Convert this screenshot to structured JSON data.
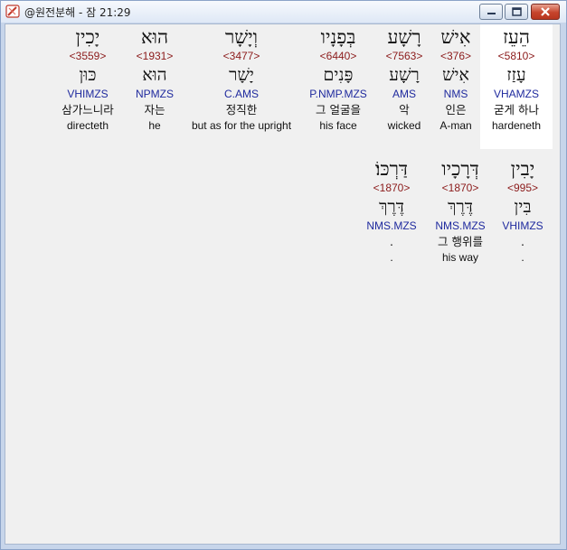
{
  "window": {
    "title": "@원전분해 - 잠 21:29"
  },
  "rows": [
    {
      "words": [
        {
          "hebrew": "הֵעֵז",
          "strongs": "<5810>",
          "lexeme": "עָזַז",
          "parsing": "VHAMZS",
          "korean": "굳게 하나",
          "english": "hardeneth",
          "highlighted": true
        },
        {
          "hebrew": "אִישׁ",
          "strongs": "<376>",
          "lexeme": "אִישׁ",
          "parsing": "NMS",
          "korean": "인은",
          "english": "A-man"
        },
        {
          "hebrew": "רָשָׁע",
          "strongs": "<7563>",
          "lexeme": "רָשָׁע",
          "parsing": "AMS",
          "korean": "악",
          "english": "wicked"
        },
        {
          "hebrew": "בְּפָנָיו",
          "strongs": "<6440>",
          "lexeme": "פָּנִים",
          "parsing": "P.NMP.MZS",
          "korean": "그 얼굴을",
          "english": "his face"
        },
        {
          "hebrew": "וְיָשָׁר",
          "strongs": "<3477>",
          "lexeme": "יָשָׁר",
          "parsing": "C.AMS",
          "korean": "정직한",
          "english": "but as for the upright"
        },
        {
          "hebrew": "הוּא",
          "strongs": "<1931>",
          "lexeme": "הוּא",
          "parsing": "NPMZS",
          "korean": "자는",
          "english": "he"
        },
        {
          "hebrew": "יָכִין",
          "strongs": "<3559>",
          "lexeme": "כּוּן",
          "parsing": "VHIMZS",
          "korean": "삼가느니라",
          "english": "directeth"
        }
      ]
    },
    {
      "words": [
        {
          "hebrew": "יָבִין",
          "strongs": "<995>",
          "lexeme": "בִּין",
          "parsing": "VHIMZS",
          "korean": ".",
          "english": "."
        },
        {
          "hebrew": "דְּרָכָיו",
          "strongs": "<1870>",
          "lexeme": "דֶּרֶךְ",
          "parsing": "NMS.MZS",
          "korean": "그 행위를",
          "english": "his way"
        },
        {
          "hebrew": "דַּרְכּוֹ׃",
          "strongs": "<1870>",
          "lexeme": "דֶּרֶךְ",
          "parsing": "NMS.MZS",
          "korean": ".",
          "english": "."
        }
      ]
    }
  ]
}
